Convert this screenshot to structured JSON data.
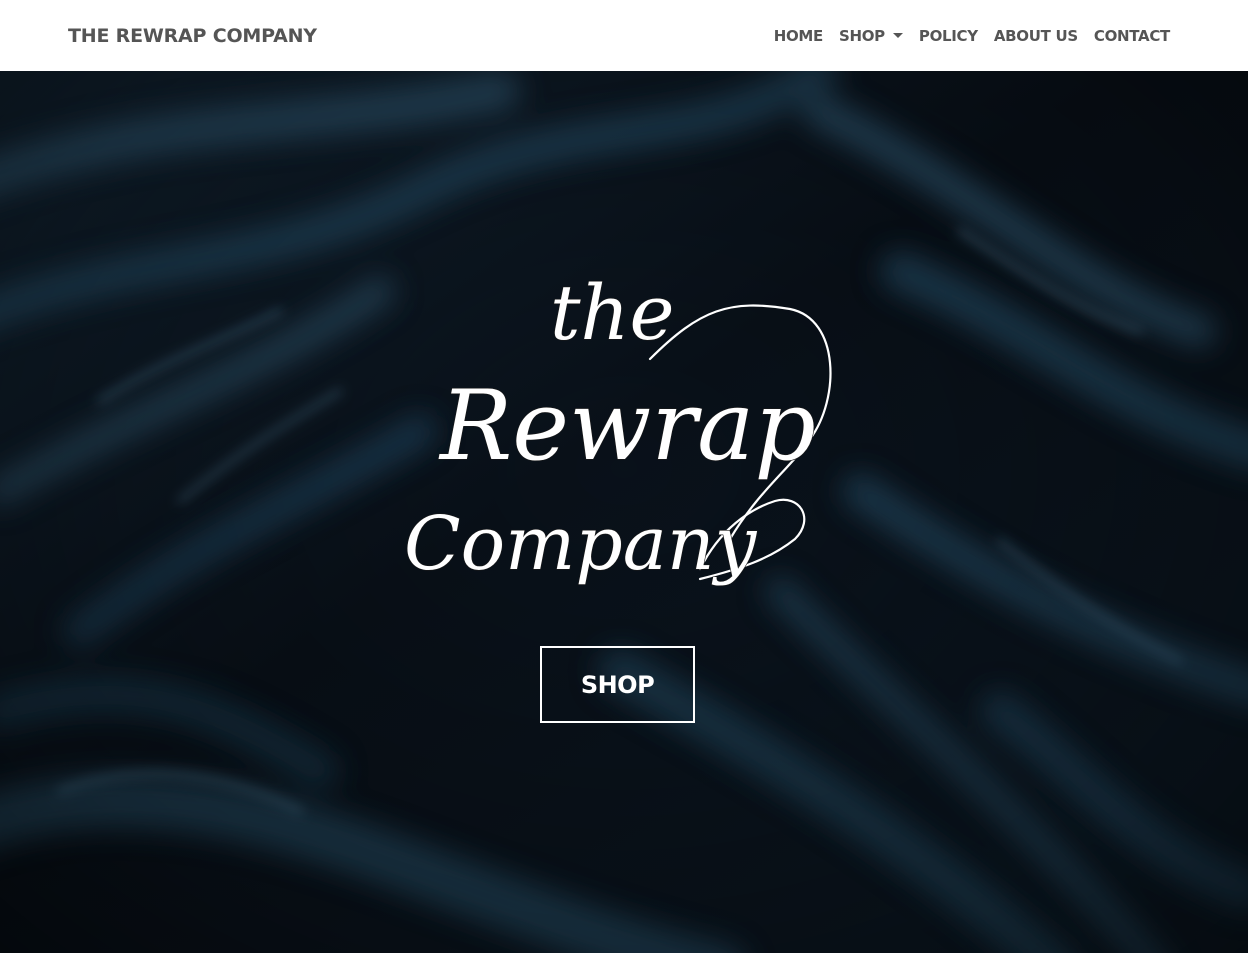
{
  "navbar": {
    "brand": "THE REWRAP COMPANY",
    "links": [
      {
        "label": "HOME"
      },
      {
        "label": "SHOP",
        "has_dropdown": true
      },
      {
        "label": "POLICY"
      },
      {
        "label": "ABOUT US"
      },
      {
        "label": "CONTACT"
      }
    ]
  },
  "hero": {
    "logo": {
      "line1": "the",
      "line2": "Rewrap",
      "line3": "Company"
    },
    "button_label": "SHOP",
    "background": "dark teal knitted fabric (blurred)"
  },
  "colors": {
    "nav_text": "#555555",
    "nav_bg": "#ffffff",
    "hero_dark": "#0b1520",
    "hero_teal": "#2d5670",
    "button_text": "#ffffff"
  },
  "icons": [
    "dropdown-caret-icon"
  ]
}
